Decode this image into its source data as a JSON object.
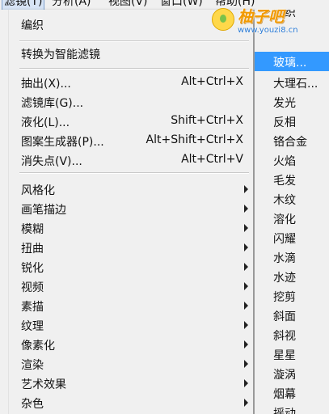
{
  "menubar": {
    "items": [
      {
        "label": "滤镜(T)"
      },
      {
        "label": "分析(A)"
      },
      {
        "label": "视图(V)"
      },
      {
        "label": "窗口(W)"
      },
      {
        "label": "帮助(H)"
      }
    ]
  },
  "menu": {
    "edit_item": "编织",
    "convert_smart": "转换为智能滤镜",
    "extract": {
      "label": "抽出(X)...",
      "shortcut": "Alt+Ctrl+X"
    },
    "gallery": {
      "label": "滤镜库(G)..."
    },
    "liquify": {
      "label": "液化(L)...",
      "shortcut": "Shift+Ctrl+X"
    },
    "pattern": {
      "label": "图案生成器(P)...",
      "shortcut": "Alt+Shift+Ctrl+X"
    },
    "vanishing": {
      "label": "消失点(V)...",
      "shortcut": "Alt+Ctrl+V"
    },
    "categories": [
      "风格化",
      "画笔描边",
      "模糊",
      "扭曲",
      "锐化",
      "视频",
      "素描",
      "纹理",
      "像素化",
      "渲染",
      "艺术效果",
      "杂色"
    ]
  },
  "submenu": {
    "items": [
      "编织",
      "玻璃...",
      "大理石...",
      "发光",
      "反相",
      "铬合金",
      "火焰",
      "毛发",
      "木纹",
      "溶化",
      "闪耀",
      "水滴",
      "水迹",
      "挖剪",
      "斜面",
      "斜视",
      "星星",
      "漩涡",
      "烟幕",
      "摇动"
    ],
    "highlighted_index": 1
  },
  "watermark": {
    "title": "柚子吧",
    "url": "www.youzi8.cn",
    "color": "#f29a00"
  }
}
